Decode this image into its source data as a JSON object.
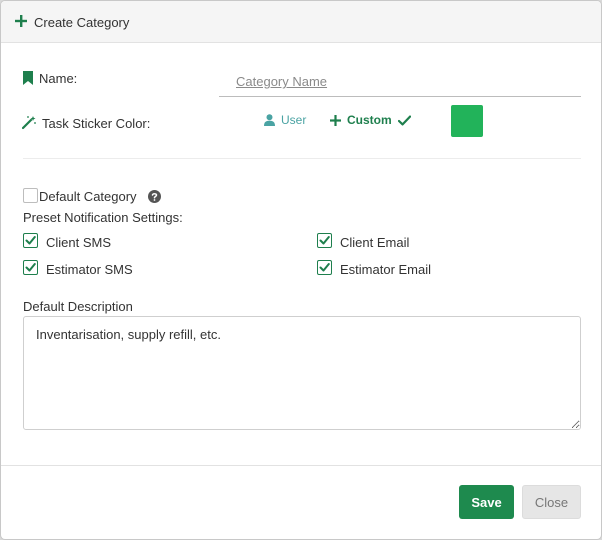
{
  "header": {
    "title": "Create Category"
  },
  "name_field": {
    "label": "Name:",
    "value": "",
    "placeholder": "Category Name"
  },
  "sticker_color": {
    "label": "Task Sticker Color:",
    "options": [
      {
        "label": "User",
        "icon": "user-icon"
      },
      {
        "label": "Custom",
        "icon": "plus-icon",
        "selected": true
      }
    ],
    "custom_color": "#22b35a"
  },
  "default_category": {
    "label": "Default Category",
    "checked": false,
    "help_icon": "question-circle-icon"
  },
  "notifications": {
    "label": "Preset Notification Settings:",
    "items": [
      {
        "label": "Client SMS",
        "checked": true
      },
      {
        "label": "Client Email",
        "checked": true
      },
      {
        "label": "Estimator SMS",
        "checked": true
      },
      {
        "label": "Estimator Email",
        "checked": true
      }
    ]
  },
  "description": {
    "label": "Default Description",
    "value": "Inventarisation, supply refill, etc."
  },
  "footer": {
    "save_label": "Save",
    "close_label": "Close"
  },
  "colors": {
    "accent": "#1e7f4d",
    "save_bg": "#1e8a4e",
    "user_option": "#4aa3a3"
  }
}
